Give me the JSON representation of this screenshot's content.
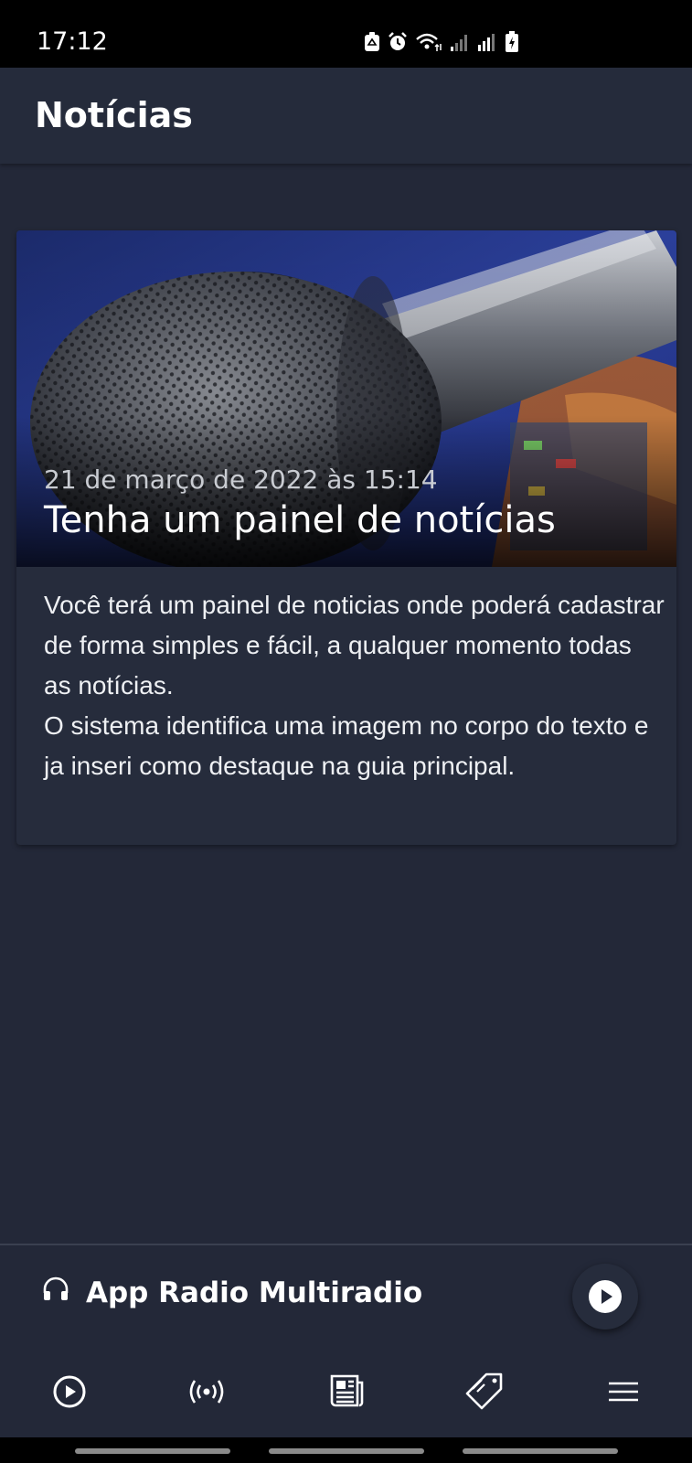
{
  "status_bar": {
    "time": "17:12"
  },
  "app_bar": {
    "title": "Notícias"
  },
  "news": [
    {
      "date": "21 de março de 2022 às 15:14",
      "title": "Tenha um painel de notícias",
      "body": [
        "Você terá um painel de noticias onde poderá cadastrar de forma simples e fácil, a qualquer momento todas as notícias.",
        "O sistema identifica uma imagem no corpo do texto e ja inseri como destaque na guia principal."
      ],
      "image_icon": "microphone-photo"
    }
  ],
  "player": {
    "station_name": "App Radio Multiradio",
    "icons": {
      "station": "headphones-icon",
      "action": "play-icon"
    }
  },
  "bottom_nav": {
    "items": [
      {
        "icon": "play-circle-icon"
      },
      {
        "icon": "broadcast-icon"
      },
      {
        "icon": "newspaper-icon"
      },
      {
        "icon": "tag-icon"
      },
      {
        "icon": "menu-icon"
      }
    ]
  },
  "colors": {
    "background": "#232838",
    "card": "#262c3c",
    "status_bar": "#000000",
    "text": "#ffffff"
  }
}
